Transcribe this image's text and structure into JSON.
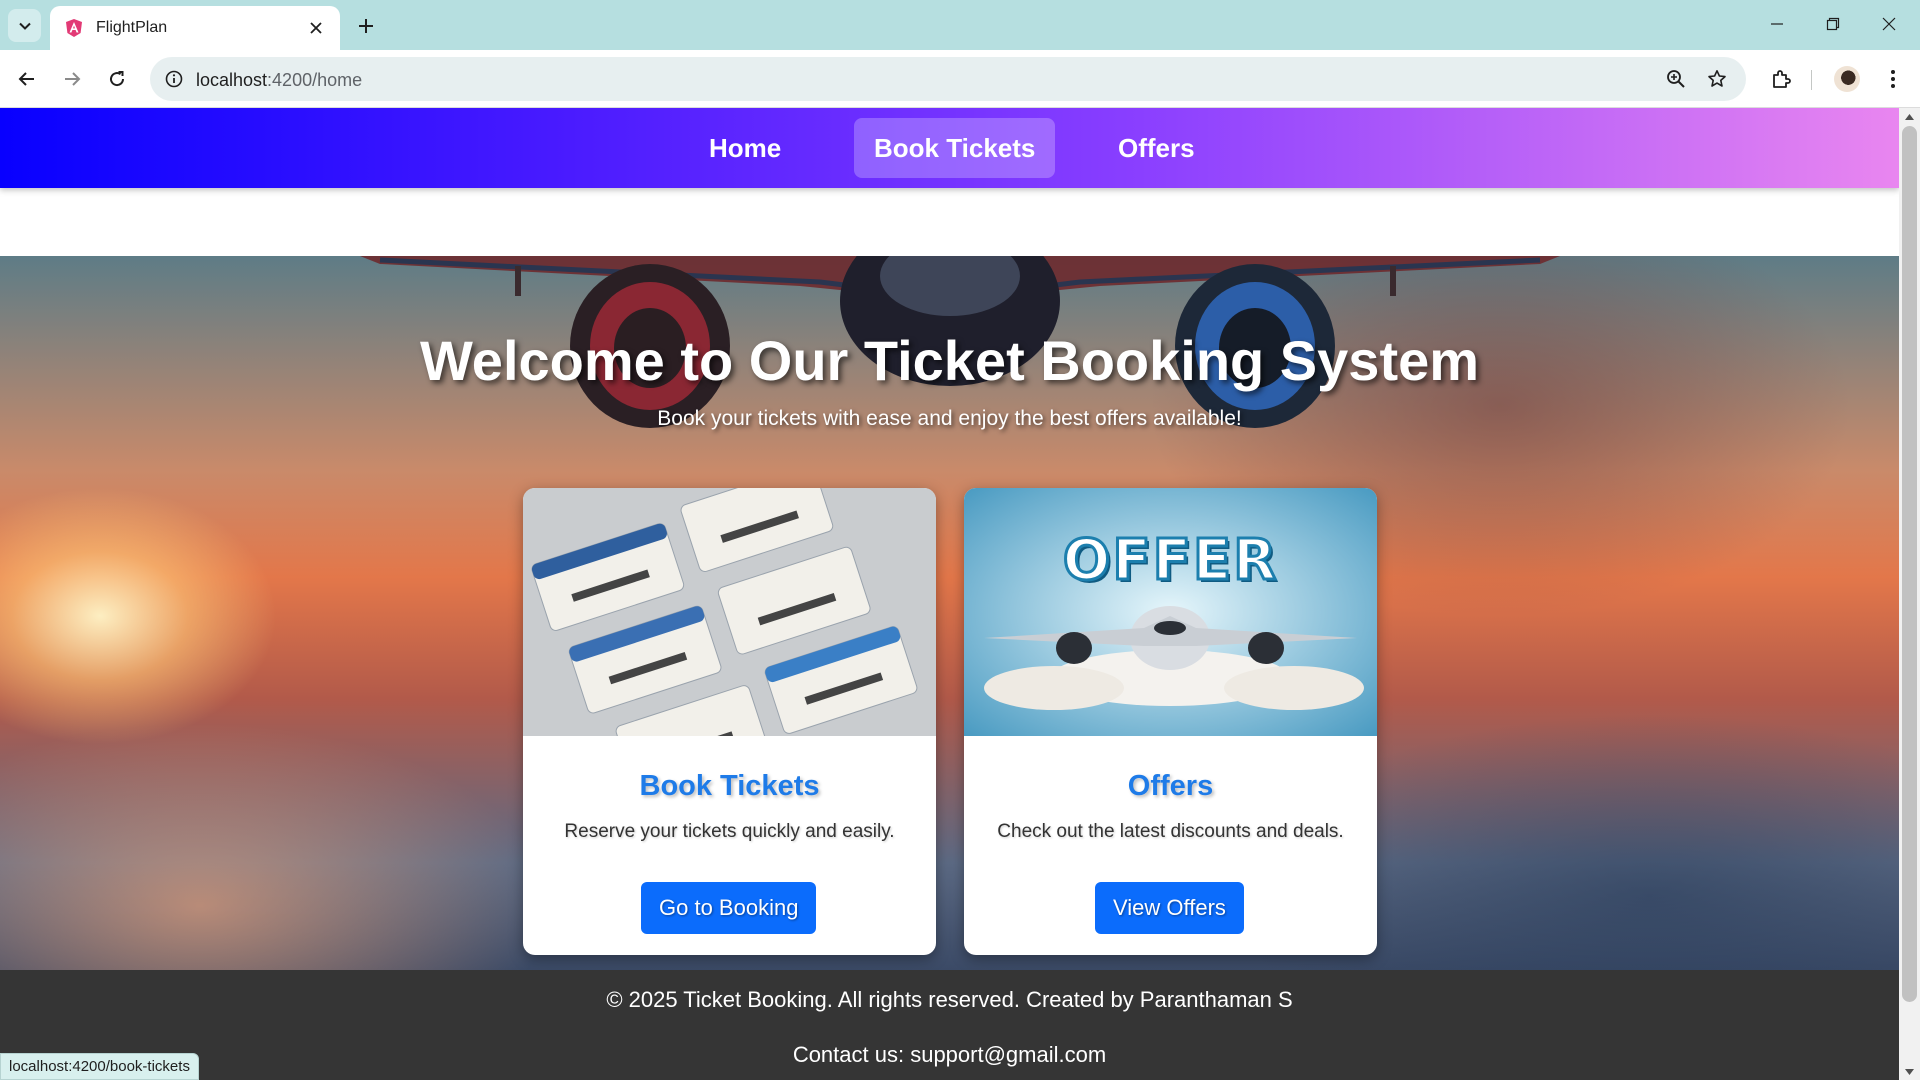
{
  "browser": {
    "tab_title": "FlightPlan",
    "url_host": "localhost",
    "url_path": ":4200/home",
    "status_url": "localhost:4200/book-tickets"
  },
  "nav": {
    "items": [
      {
        "label": "Home",
        "active": false
      },
      {
        "label": "Book Tickets",
        "active": true
      },
      {
        "label": "Offers",
        "active": false
      }
    ]
  },
  "hero": {
    "title": "Welcome to Our Ticket Booking System",
    "subtitle": "Book your tickets with ease and enjoy the best offers available!"
  },
  "cards": [
    {
      "title": "Book Tickets",
      "description": "Reserve your tickets quickly and easily.",
      "button": "Go to Booking",
      "image": "flight-tickets-illustration"
    },
    {
      "title": "Offers",
      "description": "Check out the latest discounts and deals.",
      "button": "View Offers",
      "image": "offer-airplane-illustration",
      "image_text": "OFFER"
    }
  ],
  "footer": {
    "copyright": "© 2025 Ticket Booking. All rights reserved. Created by Paranthaman S",
    "contact": "Contact us: support@gmail.com"
  },
  "colors": {
    "accent": "#0b6cfc",
    "card_title": "#1e7be8",
    "footer_bg": "#353535",
    "nav_gradient_start": "#0800ff",
    "nav_gradient_end": "#e986f0"
  }
}
